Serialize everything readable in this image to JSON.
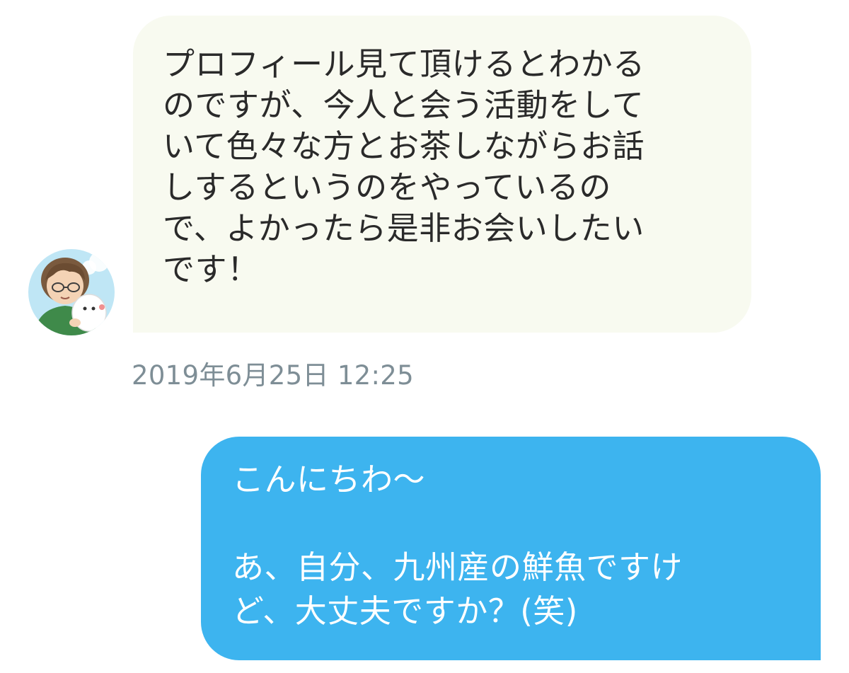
{
  "conversation": {
    "incoming": {
      "text": "プロフィール見て頂けるとわかる\nのですが、今人と会う活動をして\nいて色々な方とお茶しながらお話\nしするというのをやっているの\nで、よかったら是非お会いしたい\nです！",
      "avatar_icon": "user-avatar-icon",
      "bubble_color": "#f8faf0",
      "timestamp": "2019年6月25日 12:25"
    },
    "outgoing": {
      "text": "こんにちわ〜\n\nあ、自分、九州産の鮮魚ですけ\nど、大丈夫ですか？(笑)",
      "bubble_color": "#3db4ef"
    }
  }
}
